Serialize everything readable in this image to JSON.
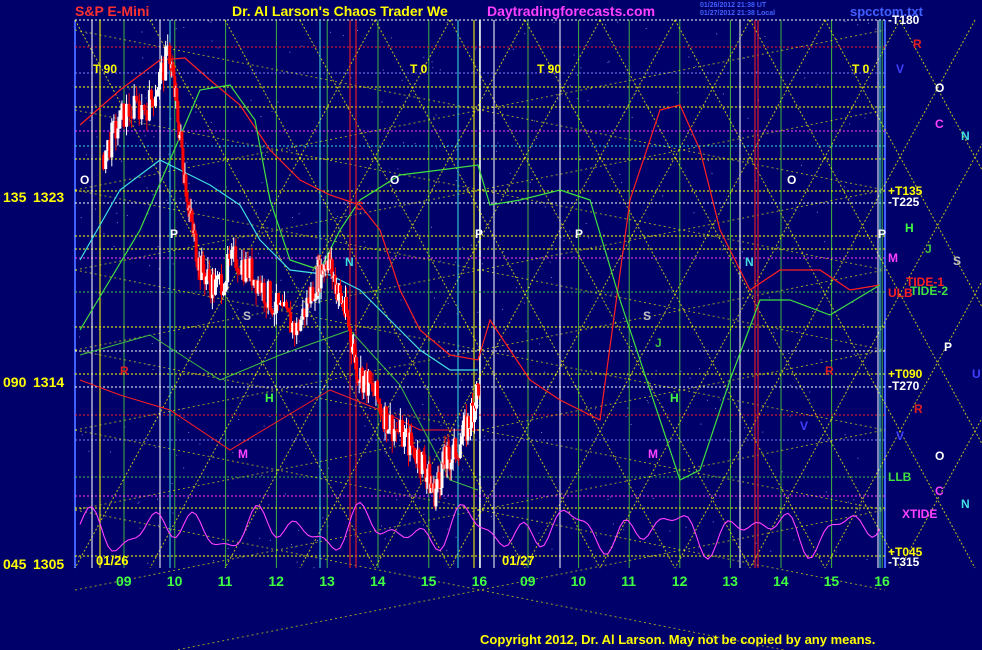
{
  "header": {
    "symbol": "S&P E-Mini",
    "title": "Dr. Al Larson's Chaos Trader We",
    "site": "Daytradingforecasts.com",
    "stamp_line1": "01/26/2012 21:38 UT",
    "stamp_line2": "01/27/2012 21:38 Local",
    "file": "spcctom.txt"
  },
  "footer": {
    "copyright": "Copyright 2012, Dr. Al Larson. May not be copied by any means."
  },
  "colors": {
    "background": "#00006b",
    "price_up": "#ffffff",
    "price_down": "#ff0000",
    "symbol_text": "#ff3030",
    "title_text": "#ffff00",
    "site_text": "#ff40ff",
    "xtide": "#ff40ff",
    "tide_line": "#ff2020",
    "ulb_llb": "#40c040",
    "forecast_cyan": "#40e0e0"
  },
  "chart_data": {
    "type": "line",
    "title": "S&P E-Mini",
    "y_axis_labels": [
      {
        "angle": "135",
        "price": "1323"
      },
      {
        "angle": "090",
        "price": "1314"
      },
      {
        "angle": "045",
        "price": "1305"
      }
    ],
    "ylim": [
      1305,
      1333
    ],
    "date_labels": [
      "01/26",
      "01/27"
    ],
    "hour_ticks": [
      "09",
      "10",
      "11",
      "12",
      "13",
      "14",
      "15",
      "16",
      "09",
      "10",
      "11",
      "12",
      "13",
      "14",
      "15",
      "16"
    ],
    "time_markers": [
      "T 90",
      "T 0",
      "T 90",
      "T 0"
    ],
    "right_labels": [
      {
        "text": "-T180",
        "color": "#ffffff"
      },
      {
        "text": "+T135",
        "color": "#ffff00"
      },
      {
        "text": "-T225",
        "color": "#ffffff"
      },
      {
        "text": "M",
        "color": "#ff40ff"
      },
      {
        "text": "TIDE-1",
        "color": "#ff2020"
      },
      {
        "text": "ULB",
        "color": "#ff2020"
      },
      {
        "text": "TIDE-2",
        "color": "#40e040"
      },
      {
        "text": "+T090",
        "color": "#ffff00"
      },
      {
        "text": "-T270",
        "color": "#ffffff"
      },
      {
        "text": "LLB",
        "color": "#40e040"
      },
      {
        "text": "XTIDE",
        "color": "#ff40ff"
      },
      {
        "text": "+T045",
        "color": "#ffff00"
      },
      {
        "text": "-T315",
        "color": "#ffffff"
      }
    ],
    "planet_legend": [
      {
        "glyph": "R",
        "color": "#e02020"
      },
      {
        "glyph": "V",
        "color": "#4040ff"
      },
      {
        "glyph": "O",
        "color": "#ffffff"
      },
      {
        "glyph": "C",
        "color": "#ff40ff"
      },
      {
        "glyph": "N",
        "color": "#40e0e0"
      },
      {
        "glyph": "H",
        "color": "#40ff40"
      },
      {
        "glyph": "J",
        "color": "#40c040"
      },
      {
        "glyph": "S",
        "color": "#c0c0c0"
      },
      {
        "glyph": "P",
        "color": "#ffffff"
      },
      {
        "glyph": "U",
        "color": "#4040ff"
      },
      {
        "glyph": "R",
        "color": "#e02020"
      },
      {
        "glyph": "V",
        "color": "#4040ff"
      },
      {
        "glyph": "O",
        "color": "#ffffff"
      },
      {
        "glyph": "C",
        "color": "#ff40ff"
      },
      {
        "glyph": "N",
        "color": "#40e0e0"
      }
    ],
    "plot_letters": [
      {
        "glyph": "O",
        "color": "#ffffff"
      },
      {
        "glyph": "P",
        "color": "#ffffff"
      },
      {
        "glyph": "N",
        "color": "#40e0e0"
      },
      {
        "glyph": "S",
        "color": "#c0c0c0"
      },
      {
        "glyph": "H",
        "color": "#40ff40"
      },
      {
        "glyph": "M",
        "color": "#ff40ff"
      },
      {
        "glyph": "R",
        "color": "#e02020"
      },
      {
        "glyph": "C",
        "color": "#e02020"
      },
      {
        "glyph": "O",
        "color": "#ffffff"
      },
      {
        "glyph": "P",
        "color": "#ffffff"
      },
      {
        "glyph": "P",
        "color": "#ffffff"
      },
      {
        "glyph": "S",
        "color": "#c0c0c0"
      },
      {
        "glyph": "J",
        "color": "#40c040"
      },
      {
        "glyph": "H",
        "color": "#40ff40"
      },
      {
        "glyph": "M",
        "color": "#ff40ff"
      },
      {
        "glyph": "N",
        "color": "#40e0e0"
      },
      {
        "glyph": "O",
        "color": "#ffffff"
      },
      {
        "glyph": "P",
        "color": "#ffffff"
      },
      {
        "glyph": "R",
        "color": "#e02020"
      },
      {
        "glyph": "V",
        "color": "#4040ff"
      }
    ],
    "series": [
      {
        "name": "price",
        "type": "candlestick",
        "hour": [
          8.6,
          9.0,
          9.5,
          9.9,
          10.1,
          10.3,
          10.5,
          10.8,
          11.2,
          11.6,
          12.0,
          12.4,
          12.8,
          13.0,
          13.2,
          13.4,
          13.6,
          13.9,
          14.2,
          14.6,
          14.9,
          15.1,
          15.3,
          15.5,
          15.8,
          16.0
        ],
        "close": [
          1325,
          1327,
          1327.5,
          1330,
          1326,
          1322,
          1319.5,
          1318.5,
          1320,
          1319,
          1317.5,
          1316.5,
          1319,
          1320,
          1318.5,
          1317,
          1314.5,
          1313.5,
          1312,
          1311,
          1310,
          1308.5,
          1310,
          1310.5,
          1312,
          1314
        ]
      },
      {
        "name": "TIDE-1",
        "color": "#ff2020"
      },
      {
        "name": "TIDE-2",
        "color": "#40e040"
      },
      {
        "name": "XTIDE",
        "color": "#ff40ff"
      },
      {
        "name": "ULB",
        "color": "#40c040"
      },
      {
        "name": "LLB",
        "color": "#40c040"
      }
    ]
  }
}
